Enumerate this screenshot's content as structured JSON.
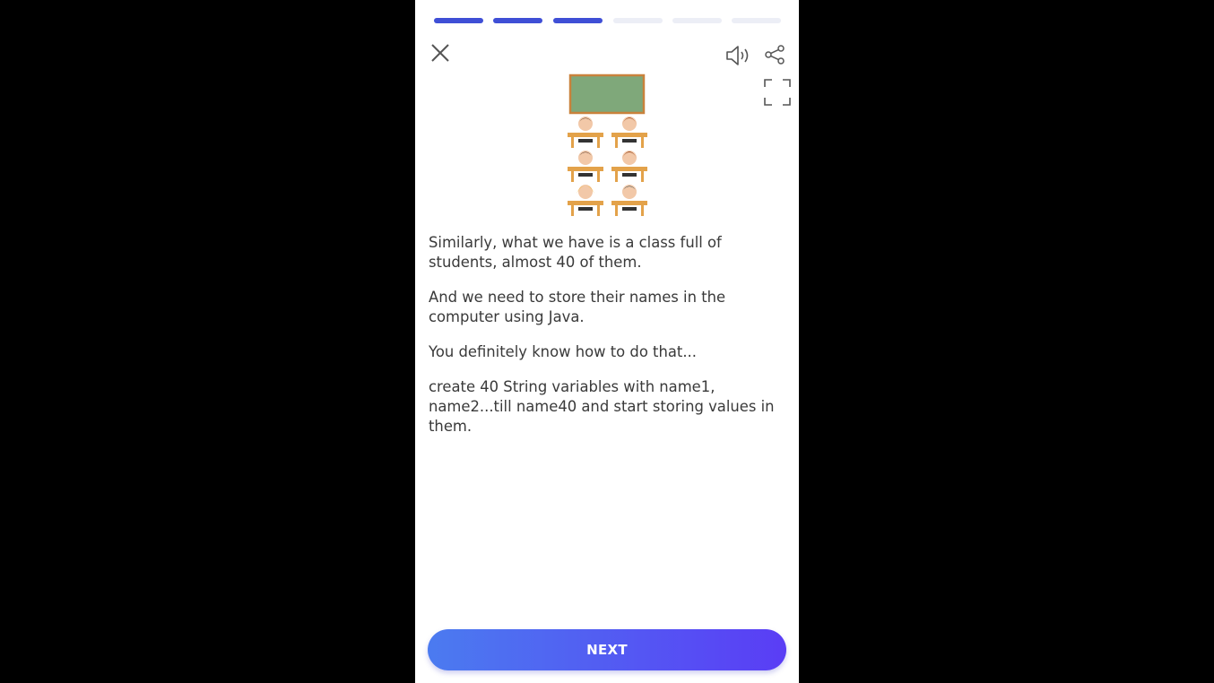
{
  "lesson": {
    "progress_total": 6,
    "progress_completed": 3,
    "paragraphs": [
      "Similarly, what we have is a class full of students, almost 40 of them.",
      "And we need to store their names in the computer using Java.",
      "You definitely know how to do that...",
      "create 40 String variables with name1, name2...till name40 and start storing values in them."
    ],
    "next_label": "NEXT"
  },
  "icons": {
    "close": "close-icon",
    "sound": "speaker-icon",
    "share": "share-icon",
    "fullscreen": "fullscreen-icon",
    "illustration": "classroom-illustration"
  },
  "colors": {
    "progress_done": "#3f4fd6",
    "progress_todo": "#eceef6",
    "button_start": "#4b7bf0",
    "button_end": "#5a3df5"
  }
}
